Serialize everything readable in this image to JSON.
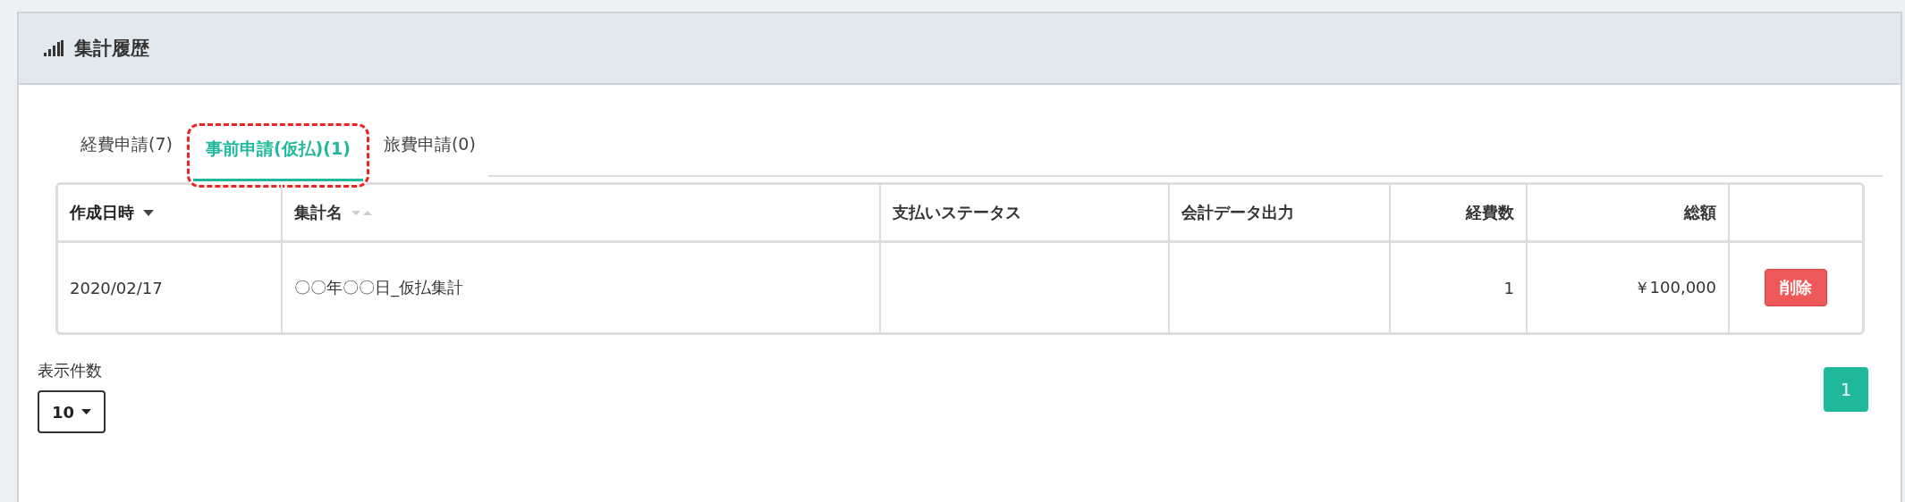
{
  "panel": {
    "title": "集計履歴"
  },
  "tabs": [
    {
      "label": "経費申請(7)",
      "selected": false,
      "annotated": false
    },
    {
      "label": "事前申請(仮払)(1)",
      "selected": true,
      "annotated": true
    },
    {
      "label": "旅費申請(0)",
      "selected": false,
      "annotated": false
    }
  ],
  "table": {
    "columns": [
      {
        "label": "作成日時",
        "sortable": true,
        "sorted": true
      },
      {
        "label": "集計名",
        "sortable": true,
        "sorted": false
      },
      {
        "label": "支払いステータス"
      },
      {
        "label": "会計データ出力"
      },
      {
        "label": "経費数"
      },
      {
        "label": "総額"
      }
    ],
    "rows": [
      {
        "cells": [
          "2020/02/17",
          "〇〇年〇〇日_仮払集計",
          "",
          "",
          "1",
          "￥100,000"
        ],
        "action": "削除"
      }
    ]
  },
  "page_size": {
    "label": "表示件数",
    "value": "10"
  },
  "pagination": [
    {
      "label": "1",
      "selected": true
    }
  ]
}
